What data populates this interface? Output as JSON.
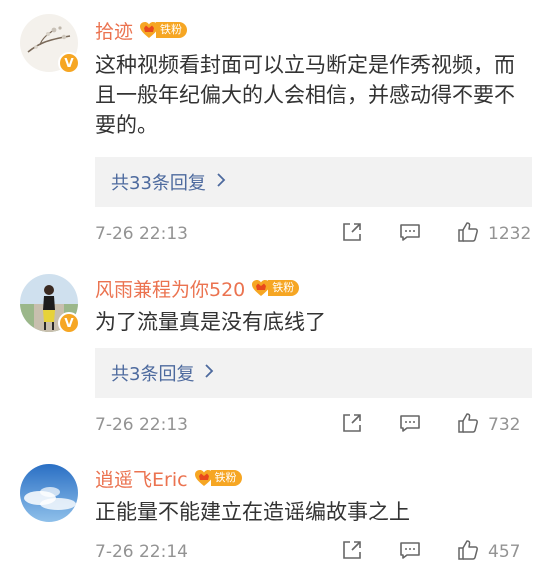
{
  "comments": [
    {
      "username": "拾迹",
      "fan_label": "铁粉",
      "verified_badge": "V",
      "text": "这种视频看封面可以立马断定是作秀视频，而且一般年纪偏大的人会相信，并感动得不要不要的。",
      "replies_label": "共33条回复",
      "time": "7-26 22:13",
      "likes": "1232"
    },
    {
      "username": "风雨兼程为你520",
      "fan_label": "铁粉",
      "verified_badge": "V",
      "text": "为了流量真是没有底线了",
      "replies_label": "共3条回复",
      "time": "7-26 22:13",
      "likes": "732"
    },
    {
      "username": "逍遥飞Eric",
      "fan_label": "铁粉",
      "text": "正能量不能建立在造谣编故事之上",
      "time": "7-26 22:14",
      "likes": "457"
    }
  ],
  "icons": {
    "reply_chevron": "chevron-right-icon",
    "share": "share-icon",
    "comment": "comment-icon",
    "like": "thumbs-up-icon"
  },
  "colors": {
    "username": "#eb7350",
    "replies_link": "#4d6a9e",
    "fan_badge": "#f6a623",
    "meta_gray": "#939393"
  }
}
